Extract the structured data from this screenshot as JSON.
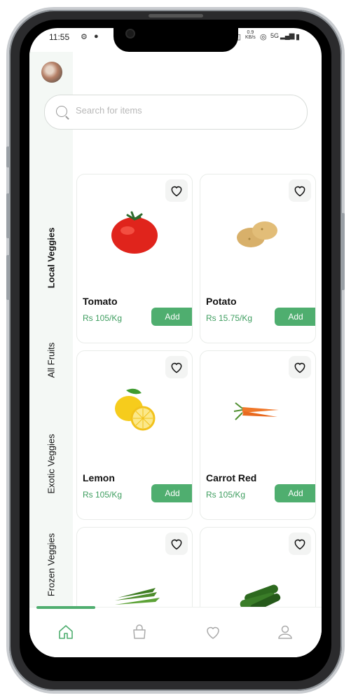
{
  "status_bar": {
    "time": "11:55",
    "network_speed_top": "0.9",
    "network_speed_unit": "KB/s",
    "network_type": "5G"
  },
  "sidebar": {
    "categories": [
      {
        "label": "Local Veggies",
        "active": true
      },
      {
        "label": "All Fruits",
        "active": false
      },
      {
        "label": "Exotic Veggies",
        "active": false
      },
      {
        "label": "Frozen Veggies",
        "active": false
      }
    ]
  },
  "search": {
    "placeholder": "Search for items",
    "value": ""
  },
  "products": [
    {
      "name": "Tomato",
      "price": "Rs 105/Kg",
      "add_label": "Add",
      "icon": "tomato"
    },
    {
      "name": "Potato",
      "price": "Rs 15.75/Kg",
      "add_label": "Add",
      "icon": "potato"
    },
    {
      "name": "Lemon",
      "price": "Rs 105/Kg",
      "add_label": "Add",
      "icon": "lemon"
    },
    {
      "name": "Carrot Red",
      "price": "Rs 105/Kg",
      "add_label": "Add",
      "icon": "carrot"
    },
    {
      "name": "",
      "price": "",
      "add_label": "",
      "icon": "okra"
    },
    {
      "name": "",
      "price": "",
      "add_label": "",
      "icon": "cucumber"
    }
  ],
  "bottom_nav": [
    {
      "icon": "home-icon",
      "active": true
    },
    {
      "icon": "bag-icon",
      "active": false
    },
    {
      "icon": "heart-icon",
      "active": false
    },
    {
      "icon": "profile-icon",
      "active": false
    }
  ],
  "colors": {
    "accent": "#4fae6f",
    "price": "#3f9e60",
    "sidebar_bg": "#f4f8f5"
  }
}
